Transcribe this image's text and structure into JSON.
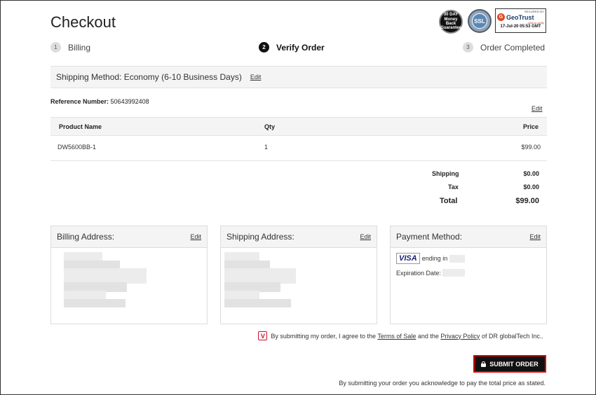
{
  "page": {
    "title": "Checkout"
  },
  "badges": {
    "money_back": [
      "30 DAY",
      "Money Back",
      "Guarantee"
    ],
    "ssl": "SSL",
    "geotrust": {
      "secured_by": "SECURED BY",
      "brand": "GeoTrust",
      "click": "click to verify",
      "timestamp": "17-Jul-20 05:53 GMT"
    }
  },
  "steps": [
    {
      "num": "1",
      "label": "Billing",
      "active": false
    },
    {
      "num": "2",
      "label": "Verify Order",
      "active": true
    },
    {
      "num": "3",
      "label": "Order Completed",
      "active": false
    }
  ],
  "shipping_method": {
    "label": "Shipping Method:",
    "value": "Economy (6-10 Business Days)",
    "edit": "Edit"
  },
  "reference": {
    "label": "Reference Number:",
    "value": "50643992408"
  },
  "table_edit": "Edit",
  "table": {
    "headers": [
      "Product Name",
      "Qty",
      "Price"
    ],
    "rows": [
      {
        "product": "DW5600BB-1",
        "qty": "1",
        "price": "$99.00"
      }
    ]
  },
  "totals": {
    "shipping_label": "Shipping",
    "shipping_value": "$0.00",
    "tax_label": "Tax",
    "tax_value": "$0.00",
    "total_label": "Total",
    "total_value": "$99.00"
  },
  "billing": {
    "title": "Billing Address:",
    "edit": "Edit"
  },
  "shipping": {
    "title": "Shipping Address:",
    "edit": "Edit"
  },
  "payment": {
    "title": "Payment Method:",
    "edit": "Edit",
    "card_brand": "VISA",
    "ending_label": "ending in",
    "expiration_label": "Expiration Date:"
  },
  "agreement": {
    "icon": "V",
    "prefix": "By submitting my order, I agree to the",
    "terms": "Terms of Sale",
    "and": "and the",
    "privacy": "Privacy Policy",
    "suffix": "of DR globalTech Inc.."
  },
  "submit_label": "SUBMIT ORDER",
  "footer_note": "By submitting your order you acknowledge to pay the total price as stated.",
  "colors": {
    "accent": "#111111",
    "submit_border": "#e00000",
    "panel_bg": "#f4f4f4"
  }
}
